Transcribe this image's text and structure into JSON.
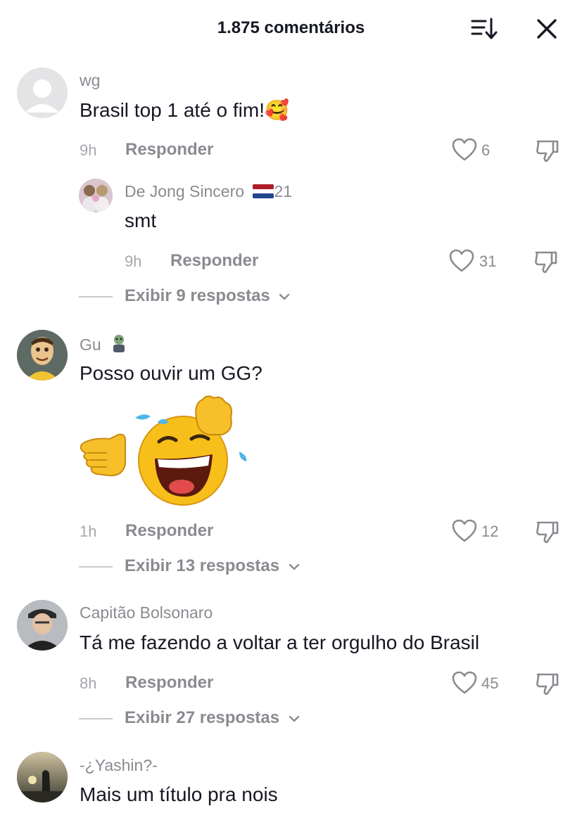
{
  "header": {
    "title": "1.875 comentários"
  },
  "comments": [
    {
      "username": "wg",
      "text": "Brasil top 1 até o fim!",
      "emoji": "🥰",
      "time": "9h",
      "reply_label": "Responder",
      "likes": "6",
      "reply": {
        "username": "De Jong Sincero",
        "username_suffix": "21",
        "text": "smt",
        "time": "9h",
        "reply_label": "Responder",
        "likes": "31"
      },
      "view_more": "Exibir 9 respostas"
    },
    {
      "username": "Gu",
      "text": "Posso ouvir um GG?",
      "time": "1h",
      "reply_label": "Responder",
      "likes": "12",
      "view_more": "Exibir 13 respostas"
    },
    {
      "username": "Capitão Bolsonaro",
      "text": "Tá me fazendo a voltar a ter orgulho do Brasil",
      "time": "8h",
      "reply_label": "Responder",
      "likes": "45",
      "view_more": "Exibir 27 respostas"
    },
    {
      "username": "-¿Yashin?-",
      "text": "Mais um título pra nois"
    }
  ],
  "colors": {
    "text": "#161823",
    "secondary": "#8a8b91",
    "time": "#a7a8ad",
    "line": "#c9cacd",
    "emoji_yellow": "#f7c02a"
  },
  "icons": {
    "sort": "sort-icon",
    "close": "close-icon",
    "like": "heart-outline-icon",
    "dislike": "thumbs-down-icon",
    "chevron": "chevron-down-icon",
    "flag": "netherlands-flag-icon",
    "sticker": "laughing-pointing-sticker"
  }
}
